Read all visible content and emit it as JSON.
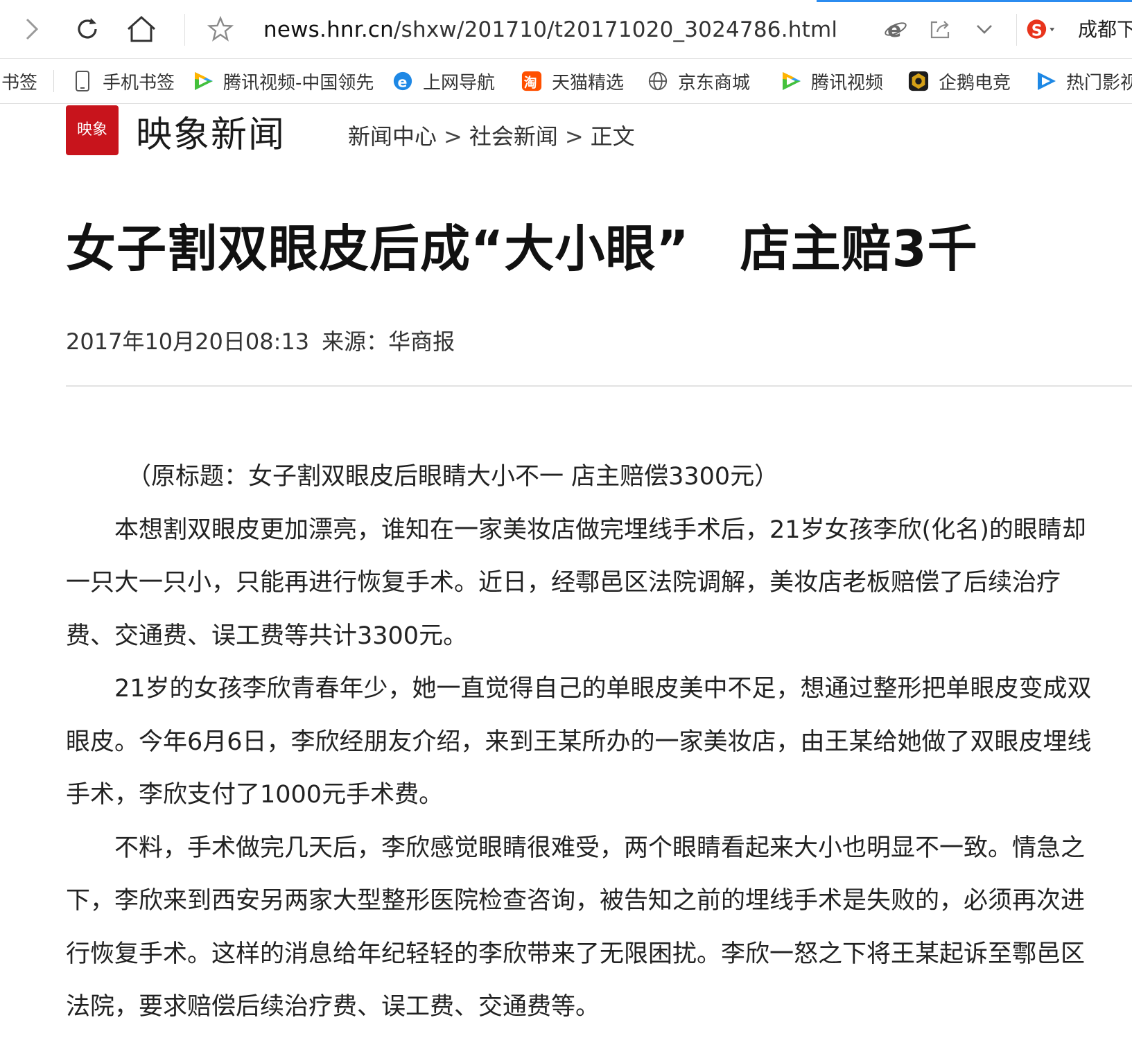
{
  "browser": {
    "url_domain": "news.hnr.cn",
    "url_path": "/shxw/201710/t20171020_3024786.html",
    "location_text": "成都下",
    "icons": [
      "forward-icon",
      "refresh-icon",
      "home-icon",
      "star-icon",
      "ie-mode-icon",
      "share-icon",
      "chevron-down-icon",
      "sogou-icon"
    ]
  },
  "bookmarks": {
    "items": [
      {
        "label": "书签"
      },
      {
        "label": "手机书签",
        "icon": "phone-icon"
      },
      {
        "label": "腾讯视频-中国领先",
        "icon": "tencent-video-icon"
      },
      {
        "label": "上网导航",
        "icon": "ie-icon"
      },
      {
        "label": "天猫精选",
        "icon": "taobao-icon"
      },
      {
        "label": "京东商城",
        "icon": "globe-icon"
      },
      {
        "label": "腾讯视频",
        "icon": "tencent-video-icon"
      },
      {
        "label": "企鹅电竞",
        "icon": "penguin-esports-icon"
      },
      {
        "label": "热门影视",
        "icon": "video-play-icon"
      }
    ]
  },
  "site": {
    "logo_chars": "映象",
    "name": "映象新闻"
  },
  "breadcrumb": {
    "items": [
      "新闻中心",
      "社会新闻",
      "正文"
    ],
    "separator": ">"
  },
  "article": {
    "title": "女子割双眼皮后成“大小眼”　店主赔3千",
    "datetime": "2017年10月20日08:13",
    "source": "来源：华商报",
    "original_title": "（原标题：女子割双眼皮后眼睛大小不一 店主赔偿3300元）",
    "paragraphs": [
      "本想割双眼皮更加漂亮，谁知在一家美妆店做完埋线手术后，21岁女孩李欣(化名)的眼睛却一只大一只小，只能再进行恢复手术。近日，经鄠邑区法院调解，美妆店老板赔偿了后续治疗费、交通费、误工费等共计3300元。",
      "21岁的女孩李欣青春年少，她一直觉得自己的单眼皮美中不足，想通过整形把单眼皮变成双眼皮。今年6月6日，李欣经朋友介绍，来到王某所办的一家美妆店，由王某给她做了双眼皮埋线手术，李欣支付了1000元手术费。",
      "不料，手术做完几天后，李欣感觉眼睛很难受，两个眼睛看起来大小也明显不一致。情急之下，李欣来到西安另两家大型整形医院检查咨询，被告知之前的埋线手术是失败的，必须再次进行恢复手术。这样的消息给年纪轻轻的李欣带来了无限困扰。李欣一怒之下将王某起诉至鄠邑区法院，要求赔偿后续治疗费、误工费、交通费等。"
    ]
  },
  "colors": {
    "accent_blue": "#2b8cf0",
    "logo_red": "#c8141c",
    "sogou_red": "#e8341c"
  }
}
